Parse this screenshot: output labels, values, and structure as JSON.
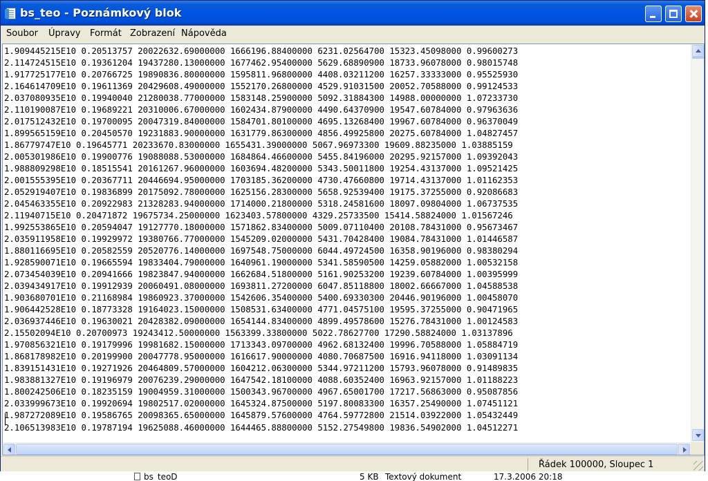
{
  "window": {
    "title": "bs_teo - Poznámkový blok"
  },
  "menu": {
    "items": [
      "Soubor",
      "Úpravy",
      "Formát",
      "Zobrazení",
      "Nápověda"
    ]
  },
  "editor": {
    "lines": [
      "1.909445215E10 0.20513757 20022632.69000000 1666196.88400000 6231.02564700 15323.45098000 0.99600273",
      "2.114724515E10 0.19361204 19437280.13000000 1677462.95400000 5629.68890900 18733.96078000 0.98015748",
      "1.917725177E10 0.20766725 19890836.80000000 1595811.96800000 4408.03211200 16257.33333000 0.95525930",
      "2.164614709E10 0.19611369 20429608.49000000 1552170.26800000 4529.91031500 20052.70588000 0.99124533",
      "2.037080935E10 0.19940040 21280038.77000000 1583148.25900000 5092.31884300 14988.00000000 1.07233730",
      "2.110190087E10 0.19689221 20310006.67000000 1602434.87900000 4490.64370900 19547.60784000 0.97963636",
      "2.017512432E10 0.19700095 20047319.84000000 1584701.80100000 4695.13268400 19967.60784000 0.96370049",
      "1.899565159E10 0.20450570 19231883.90000000 1631779.86300000 4856.49925800 20275.60784000 1.04827457",
      "1.86779747E10 0.19645771 20233670.83000000 1655431.39000000 5067.96973300 19609.88235000 1.03885159",
      "2.005301986E10 0.19900776 19088088.53000000 1684864.46600000 5455.84196000 20295.92157000 1.09392043",
      "1.988809298E10 0.18515541 20161267.96000000 1603694.48200000 5343.50011800 19254.43137000 1.09521425",
      "2.001555395E10 0.20367711 20446694.95000000 1703185.36200000 4730.47660800 19714.43137000 1.01162353",
      "2.052919407E10 0.19836899 20175092.78000000 1625156.28300000 5658.92539400 19175.37255000 0.92086683",
      "2.045463355E10 0.20922983 21328283.94000000 1714000.21800000 5318.24581600 18097.09804000 1.06737535",
      "2.11940715E10 0.20471872 19675734.25000000 1623403.57800000 4329.25733500 15414.58824000 1.01567246",
      "1.992553865E10 0.20594047 19127770.18000000 1571862.83400000 5009.07110400 20108.78431000 0.95673467",
      "2.035911958E10 0.19929972 19380766.77000000 1545209.02000000 5431.70428400 19084.78431000 1.01446587",
      "1.880116695E10 0.20582559 20520776.14000000 1697548.75000000 6044.49724500 16358.90196000 0.98380294",
      "1.928590071E10 0.19665594 19833404.79000000 1640961.19000000 5341.58590500 14259.05882000 1.00532158",
      "2.073454039E10 0.20941666 19823847.94000000 1662684.51800000 5161.90253200 19239.60784000 1.00395999",
      "2.039434917E10 0.19912939 20060491.08000000 1693811.27200000 6047.85118800 18002.66667000 1.04588538",
      "1.903680701E10 0.21168984 19860923.37000000 1542606.35400000 5400.69330300 20446.90196000 1.00458070",
      "1.906442528E10 0.18773328 19164023.15000000 1508531.63400000 4771.04575100 19595.37255000 0.90471965",
      "2.036937446E10 0.19630021 20428382.09000000 1654144.83400000 4899.49578600 15276.78431000 1.00124583",
      "2.15502094E10 0.20700973 19243412.50000000 1563399.33800000 5022.78627700 17290.58824000 1.03137896",
      "1.970856321E10 0.19179996 19981682.15000000 1713343.09700000 4962.68132400 19996.70588000 1.05884719",
      "1.868178982E10 0.20199900 20047778.95000000 1616617.90000000 4080.70687500 16916.94118000 1.03091134",
      "1.839151431E10 0.19271926 20464809.57000000 1604212.06300000 5344.97211200 15793.96078000 0.91489835",
      "1.983881327E10 0.19196979 20076239.29000000 1647542.18100000 4088.60352400 16963.92157000 1.01188223",
      "1.800242506E10 0.18235159 19004959.31000000 1500343.96700000 4967.65001700 17217.56863000 0.95087856",
      "2.033999673E10 0.19920694 19802517.02000000 1645324.87500000 5197.80083300 16357.25490000 1.07451121",
      "1.987272089E10 0.19586765 20098365.65000000 1645879.57600000 4764.59772800 21514.03922000 1.05432449",
      "2.106513983E10 0.19787194 19625088.46000000 1644465.88800000 5152.27549800 19836.54902000 1.04512271"
    ]
  },
  "statusbar": {
    "position": "Řádek 100000, Sloupec 1"
  },
  "background": {
    "file_name": "bs_teoD",
    "file_size": "5 KB",
    "file_type": "Textový dokument",
    "file_date": "17.3.2006 20:18"
  },
  "colors": {
    "titlebar": "#0054e3",
    "chrome": "#ece9d8",
    "close_button": "#c8411e"
  },
  "icons": [
    "notepad-icon",
    "minimize-icon",
    "maximize-icon",
    "close-icon",
    "scroll-up-icon",
    "scroll-down-icon",
    "scroll-left-icon",
    "scroll-right-icon",
    "size-grip-icon"
  ]
}
